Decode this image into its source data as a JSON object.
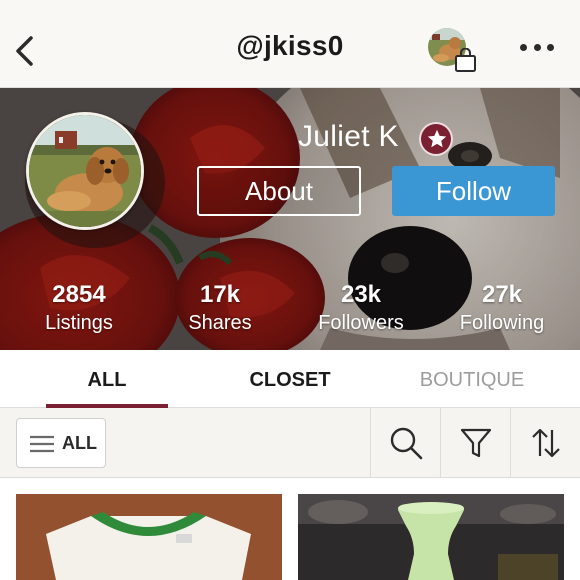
{
  "header": {
    "back_icon": "chevron-left-icon",
    "username": "@jkiss0",
    "shop_icon": "shopping-bag-icon",
    "more_icon": "more-horizontal-icon"
  },
  "profile": {
    "name": "Juliet K",
    "badge_icon": "star-icon",
    "about_label": "About",
    "follow_label": "Follow",
    "follow_color": "#3b97d3",
    "badge_color": "#7b1f33",
    "stats": [
      {
        "value": "2854",
        "label": "Listings"
      },
      {
        "value": "17k",
        "label": "Shares"
      },
      {
        "value": "23k",
        "label": "Followers"
      },
      {
        "value": "27k",
        "label": "Following"
      }
    ]
  },
  "tabs": [
    {
      "label": "ALL",
      "active": true
    },
    {
      "label": "CLOSET",
      "active": false
    },
    {
      "label": "BOUTIQUE",
      "active": false
    }
  ],
  "filters": {
    "all_label": "ALL",
    "menu_icon": "menu-icon",
    "search_icon": "search-icon",
    "filter_icon": "filter-funnel-icon",
    "sort_icon": "sort-arrows-icon"
  }
}
